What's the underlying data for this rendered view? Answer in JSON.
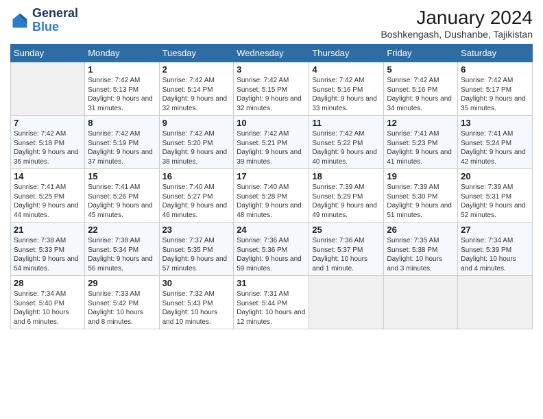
{
  "header": {
    "logo": {
      "line1": "General",
      "line2": "Blue"
    },
    "title": "January 2024",
    "subtitle": "Boshkengash, Dushanbe, Tajikistan"
  },
  "days_of_week": [
    "Sunday",
    "Monday",
    "Tuesday",
    "Wednesday",
    "Thursday",
    "Friday",
    "Saturday"
  ],
  "weeks": [
    {
      "days": [
        {
          "num": "",
          "empty": true
        },
        {
          "num": "1",
          "sunrise": "Sunrise: 7:42 AM",
          "sunset": "Sunset: 5:13 PM",
          "daylight": "Daylight: 9 hours and 31 minutes."
        },
        {
          "num": "2",
          "sunrise": "Sunrise: 7:42 AM",
          "sunset": "Sunset: 5:14 PM",
          "daylight": "Daylight: 9 hours and 32 minutes."
        },
        {
          "num": "3",
          "sunrise": "Sunrise: 7:42 AM",
          "sunset": "Sunset: 5:15 PM",
          "daylight": "Daylight: 9 hours and 32 minutes."
        },
        {
          "num": "4",
          "sunrise": "Sunrise: 7:42 AM",
          "sunset": "Sunset: 5:16 PM",
          "daylight": "Daylight: 9 hours and 33 minutes."
        },
        {
          "num": "5",
          "sunrise": "Sunrise: 7:42 AM",
          "sunset": "Sunset: 5:16 PM",
          "daylight": "Daylight: 9 hours and 34 minutes."
        },
        {
          "num": "6",
          "sunrise": "Sunrise: 7:42 AM",
          "sunset": "Sunset: 5:17 PM",
          "daylight": "Daylight: 9 hours and 35 minutes."
        }
      ]
    },
    {
      "days": [
        {
          "num": "7",
          "sunrise": "Sunrise: 7:42 AM",
          "sunset": "Sunset: 5:18 PM",
          "daylight": "Daylight: 9 hours and 36 minutes."
        },
        {
          "num": "8",
          "sunrise": "Sunrise: 7:42 AM",
          "sunset": "Sunset: 5:19 PM",
          "daylight": "Daylight: 9 hours and 37 minutes."
        },
        {
          "num": "9",
          "sunrise": "Sunrise: 7:42 AM",
          "sunset": "Sunset: 5:20 PM",
          "daylight": "Daylight: 9 hours and 38 minutes."
        },
        {
          "num": "10",
          "sunrise": "Sunrise: 7:42 AM",
          "sunset": "Sunset: 5:21 PM",
          "daylight": "Daylight: 9 hours and 39 minutes."
        },
        {
          "num": "11",
          "sunrise": "Sunrise: 7:42 AM",
          "sunset": "Sunset: 5:22 PM",
          "daylight": "Daylight: 9 hours and 40 minutes."
        },
        {
          "num": "12",
          "sunrise": "Sunrise: 7:41 AM",
          "sunset": "Sunset: 5:23 PM",
          "daylight": "Daylight: 9 hours and 41 minutes."
        },
        {
          "num": "13",
          "sunrise": "Sunrise: 7:41 AM",
          "sunset": "Sunset: 5:24 PM",
          "daylight": "Daylight: 9 hours and 42 minutes."
        }
      ]
    },
    {
      "days": [
        {
          "num": "14",
          "sunrise": "Sunrise: 7:41 AM",
          "sunset": "Sunset: 5:25 PM",
          "daylight": "Daylight: 9 hours and 44 minutes."
        },
        {
          "num": "15",
          "sunrise": "Sunrise: 7:41 AM",
          "sunset": "Sunset: 5:26 PM",
          "daylight": "Daylight: 9 hours and 45 minutes."
        },
        {
          "num": "16",
          "sunrise": "Sunrise: 7:40 AM",
          "sunset": "Sunset: 5:27 PM",
          "daylight": "Daylight: 9 hours and 46 minutes."
        },
        {
          "num": "17",
          "sunrise": "Sunrise: 7:40 AM",
          "sunset": "Sunset: 5:28 PM",
          "daylight": "Daylight: 9 hours and 48 minutes."
        },
        {
          "num": "18",
          "sunrise": "Sunrise: 7:39 AM",
          "sunset": "Sunset: 5:29 PM",
          "daylight": "Daylight: 9 hours and 49 minutes."
        },
        {
          "num": "19",
          "sunrise": "Sunrise: 7:39 AM",
          "sunset": "Sunset: 5:30 PM",
          "daylight": "Daylight: 9 hours and 51 minutes."
        },
        {
          "num": "20",
          "sunrise": "Sunrise: 7:39 AM",
          "sunset": "Sunset: 5:31 PM",
          "daylight": "Daylight: 9 hours and 52 minutes."
        }
      ]
    },
    {
      "days": [
        {
          "num": "21",
          "sunrise": "Sunrise: 7:38 AM",
          "sunset": "Sunset: 5:33 PM",
          "daylight": "Daylight: 9 hours and 54 minutes."
        },
        {
          "num": "22",
          "sunrise": "Sunrise: 7:38 AM",
          "sunset": "Sunset: 5:34 PM",
          "daylight": "Daylight: 9 hours and 56 minutes."
        },
        {
          "num": "23",
          "sunrise": "Sunrise: 7:37 AM",
          "sunset": "Sunset: 5:35 PM",
          "daylight": "Daylight: 9 hours and 57 minutes."
        },
        {
          "num": "24",
          "sunrise": "Sunrise: 7:36 AM",
          "sunset": "Sunset: 5:36 PM",
          "daylight": "Daylight: 9 hours and 59 minutes."
        },
        {
          "num": "25",
          "sunrise": "Sunrise: 7:36 AM",
          "sunset": "Sunset: 5:37 PM",
          "daylight": "Daylight: 10 hours and 1 minute."
        },
        {
          "num": "26",
          "sunrise": "Sunrise: 7:35 AM",
          "sunset": "Sunset: 5:38 PM",
          "daylight": "Daylight: 10 hours and 3 minutes."
        },
        {
          "num": "27",
          "sunrise": "Sunrise: 7:34 AM",
          "sunset": "Sunset: 5:39 PM",
          "daylight": "Daylight: 10 hours and 4 minutes."
        }
      ]
    },
    {
      "days": [
        {
          "num": "28",
          "sunrise": "Sunrise: 7:34 AM",
          "sunset": "Sunset: 5:40 PM",
          "daylight": "Daylight: 10 hours and 6 minutes."
        },
        {
          "num": "29",
          "sunrise": "Sunrise: 7:33 AM",
          "sunset": "Sunset: 5:42 PM",
          "daylight": "Daylight: 10 hours and 8 minutes."
        },
        {
          "num": "30",
          "sunrise": "Sunrise: 7:32 AM",
          "sunset": "Sunset: 5:43 PM",
          "daylight": "Daylight: 10 hours and 10 minutes."
        },
        {
          "num": "31",
          "sunrise": "Sunrise: 7:31 AM",
          "sunset": "Sunset: 5:44 PM",
          "daylight": "Daylight: 10 hours and 12 minutes."
        },
        {
          "num": "",
          "empty": true
        },
        {
          "num": "",
          "empty": true
        },
        {
          "num": "",
          "empty": true
        }
      ]
    }
  ]
}
